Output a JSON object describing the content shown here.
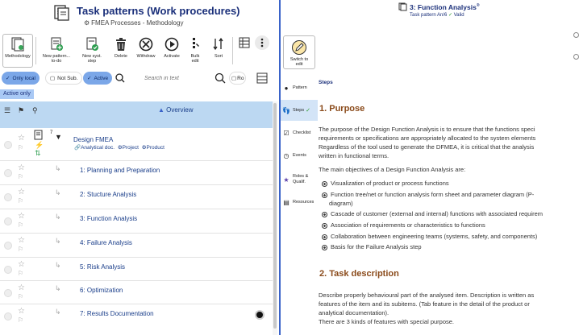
{
  "left": {
    "title": "Task patterns (Work procedures)",
    "subtitle": "FMEA Processes - Methodology",
    "toolbar": [
      {
        "icon": "methodology-icon",
        "label": "Methodology"
      },
      {
        "icon": "new-pattern-icon",
        "label": "New pattern..."
      },
      {
        "icon": "new-pattern-todo-icon",
        "label": "to-do"
      },
      {
        "icon": "new-syst-step-icon",
        "label": "New syst."
      },
      {
        "icon": "new-syst-step-icon",
        "label": "step"
      },
      {
        "icon": "delete-icon",
        "label": "Delete"
      },
      {
        "icon": "withdraw-icon",
        "label": "Withdraw"
      },
      {
        "icon": "activate-icon",
        "label": "Activate"
      },
      {
        "icon": "bulk-edit-icon",
        "label": "Bulk"
      },
      {
        "icon": "bulk-edit-icon",
        "label": "edit"
      },
      {
        "icon": "sort-icon",
        "label": "Sort"
      }
    ],
    "filters": {
      "only_local": "Only local",
      "not_sub": "Not Sub.",
      "active": "Active",
      "search_placeholder": "Search in text",
      "ro": "Ro",
      "active_only": "Active only"
    },
    "grid": {
      "overview_header": "Overview",
      "root": {
        "label": "Design FMEA",
        "tags": [
          "Analytical doc.",
          "Project",
          "Product"
        ],
        "count": "7"
      },
      "rows": [
        {
          "label": "1: Planning and Preparation"
        },
        {
          "label": "2: Stucture Analysis"
        },
        {
          "label": "3: Function Analysis"
        },
        {
          "label": "4: Failure Analysis"
        },
        {
          "label": "5: Risk Analysis"
        },
        {
          "label": "6: Optimization"
        },
        {
          "label": "7: Results Documentation"
        }
      ]
    }
  },
  "right": {
    "title": "3: Function Analysis",
    "title_mark": "®",
    "subtitle": "Task pattern An/6",
    "status": "Valid",
    "switch_label": "Switch to",
    "switch_label2": "edit",
    "tabs": [
      {
        "icon": "pattern-icon",
        "label": "Pattern"
      },
      {
        "icon": "steps-icon",
        "label": "Steps"
      },
      {
        "icon": "checklist-icon",
        "label": "Checklist"
      },
      {
        "icon": "events-icon",
        "label": "Events"
      },
      {
        "icon": "roles-icon",
        "label": "Roles &"
      },
      {
        "icon": "roles-icon",
        "label": "Qualif."
      },
      {
        "icon": "resources-icon",
        "label": "Resources"
      }
    ],
    "content": {
      "steps_label": "Steps",
      "h_purpose": "1. Purpose",
      "p1_l1": "The purpose of the Design Function Analysis is to ensure that the functions speci",
      "p1_l2": "requirements or specifications are appropriately allocated to the system elements",
      "p1_l3": "Regardless of the tool used to generate the DFMEA, it is critical that the analysis",
      "p1_l4": "written in functional terms.",
      "p2": "The main objectives of a Design Function Analysis are:",
      "bullets": [
        "Visualization of product or process functions",
        "Function tree/net or function analysis form sheet and parameter diagram (P-",
        "diagram)",
        "Cascade of customer (external and internal) functions with associated requirem",
        "Association of requirements or characteristics to functions",
        "Collaboration between engineering teams (systems, safety, and components)",
        "Basis for the Failure Analysis step"
      ],
      "h_task": "2. Task description",
      "p3_l1": "Describe properly behavioural part of the analysed item. Description is written as",
      "p3_l2": "features of the item and its subitems. (Tab feature in the detail of the product or",
      "p3_l3": "analytical documentation).",
      "p4": "There are 3 kinds of features with special purpose."
    }
  },
  "colors": {
    "accent": "#3a63c9",
    "title": "#1a2f7a",
    "heading": "#8a4a1a",
    "grid_header": "#bcd8f2",
    "pill": "#7ba7e8"
  }
}
